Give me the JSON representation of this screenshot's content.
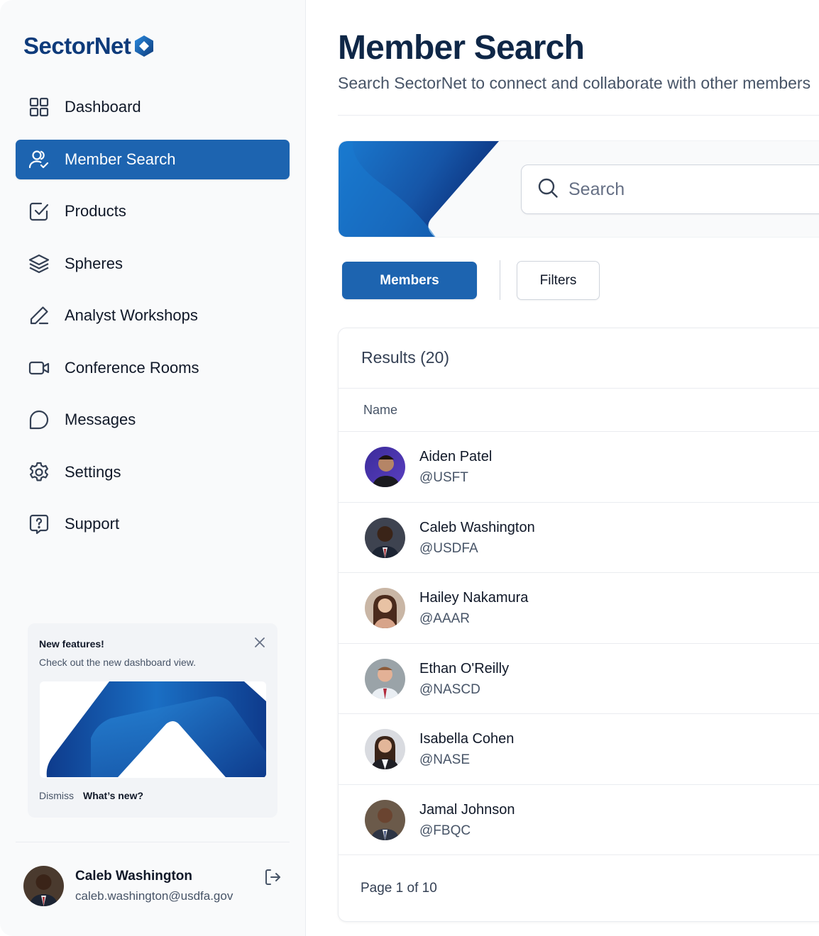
{
  "brand": {
    "name": "SectorNet",
    "primary_color": "#1d64b0",
    "dark_color": "#0e3b7b"
  },
  "sidebar": {
    "items": [
      {
        "label": "Dashboard",
        "icon": "grid-icon",
        "active": false
      },
      {
        "label": "Member Search",
        "icon": "users-check-icon",
        "active": true
      },
      {
        "label": "Products",
        "icon": "check-square-icon",
        "active": false
      },
      {
        "label": "Spheres",
        "icon": "layers-icon",
        "active": false
      },
      {
        "label": "Analyst Workshops",
        "icon": "pen-icon",
        "active": false
      },
      {
        "label": "Conference Rooms",
        "icon": "video-icon",
        "active": false
      },
      {
        "label": "Messages",
        "icon": "chat-bubble-icon",
        "active": false
      },
      {
        "label": "Settings",
        "icon": "gear-icon",
        "active": false
      },
      {
        "label": "Support",
        "icon": "help-square-icon",
        "active": false
      }
    ],
    "promo": {
      "title": "New features!",
      "text": "Check out the new dashboard view.",
      "dismiss": "Dismiss",
      "whats_new": "What’s new?"
    },
    "user": {
      "name": "Caleb Washington",
      "email": "caleb.washington@usdfa.gov"
    }
  },
  "main": {
    "title": "Member Search",
    "subtitle": "Search SectorNet to connect and collaborate with other members",
    "search": {
      "placeholder": "Search",
      "value": ""
    },
    "tabs": {
      "members": "Members",
      "filters": "Filters"
    },
    "results": {
      "title": "Results (20)",
      "column_name": "Name",
      "rows": [
        {
          "name": "Aiden Patel",
          "handle": "@USFT"
        },
        {
          "name": "Caleb Washington",
          "handle": "@USDFA"
        },
        {
          "name": "Hailey Nakamura",
          "handle": "@AAAR"
        },
        {
          "name": "Ethan O'Reilly",
          "handle": "@NASCD"
        },
        {
          "name": "Isabella Cohen",
          "handle": "@NASE"
        },
        {
          "name": "Jamal Johnson",
          "handle": "@FBQC"
        }
      ],
      "pagination": "Page 1 of 10"
    }
  }
}
